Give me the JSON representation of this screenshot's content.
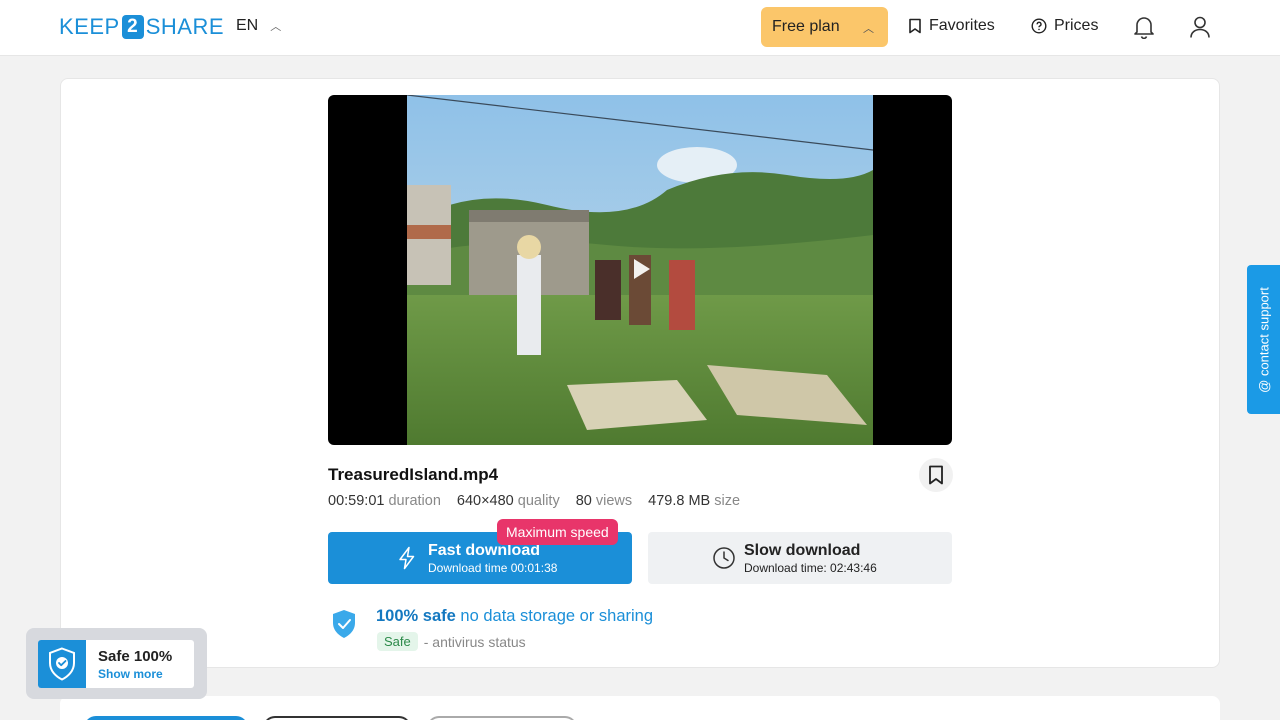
{
  "header": {
    "logo": {
      "left": "KEEP",
      "digit": "2",
      "right": "SHARE"
    },
    "language": "EN",
    "plan_label": "Free plan",
    "favorites_label": "Favorites",
    "prices_label": "Prices"
  },
  "file": {
    "name": "TreasuredIsland.mp4",
    "duration": "00:59:01",
    "duration_label": "duration",
    "quality": "640×480",
    "quality_label": "quality",
    "views": "80",
    "views_label": "views",
    "size": "479.8 MB",
    "size_label": "size"
  },
  "download": {
    "badge": "Maximum speed",
    "fast_label": "Fast download",
    "fast_time": "Download time 00:01:38",
    "slow_label": "Slow download",
    "slow_time": "Download time: 02:43:46"
  },
  "safety": {
    "headline_strong": "100% safe",
    "headline_rest": "no data storage or sharing",
    "status_chip": "Safe",
    "status_text": "- antivirus status"
  },
  "widget": {
    "title": "Safe 100%",
    "link": "Show more"
  },
  "support_label": "@ contact support",
  "colors": {
    "brand": "#1b8fd8",
    "plan": "#fbc66a",
    "badge": "#e8356a"
  }
}
